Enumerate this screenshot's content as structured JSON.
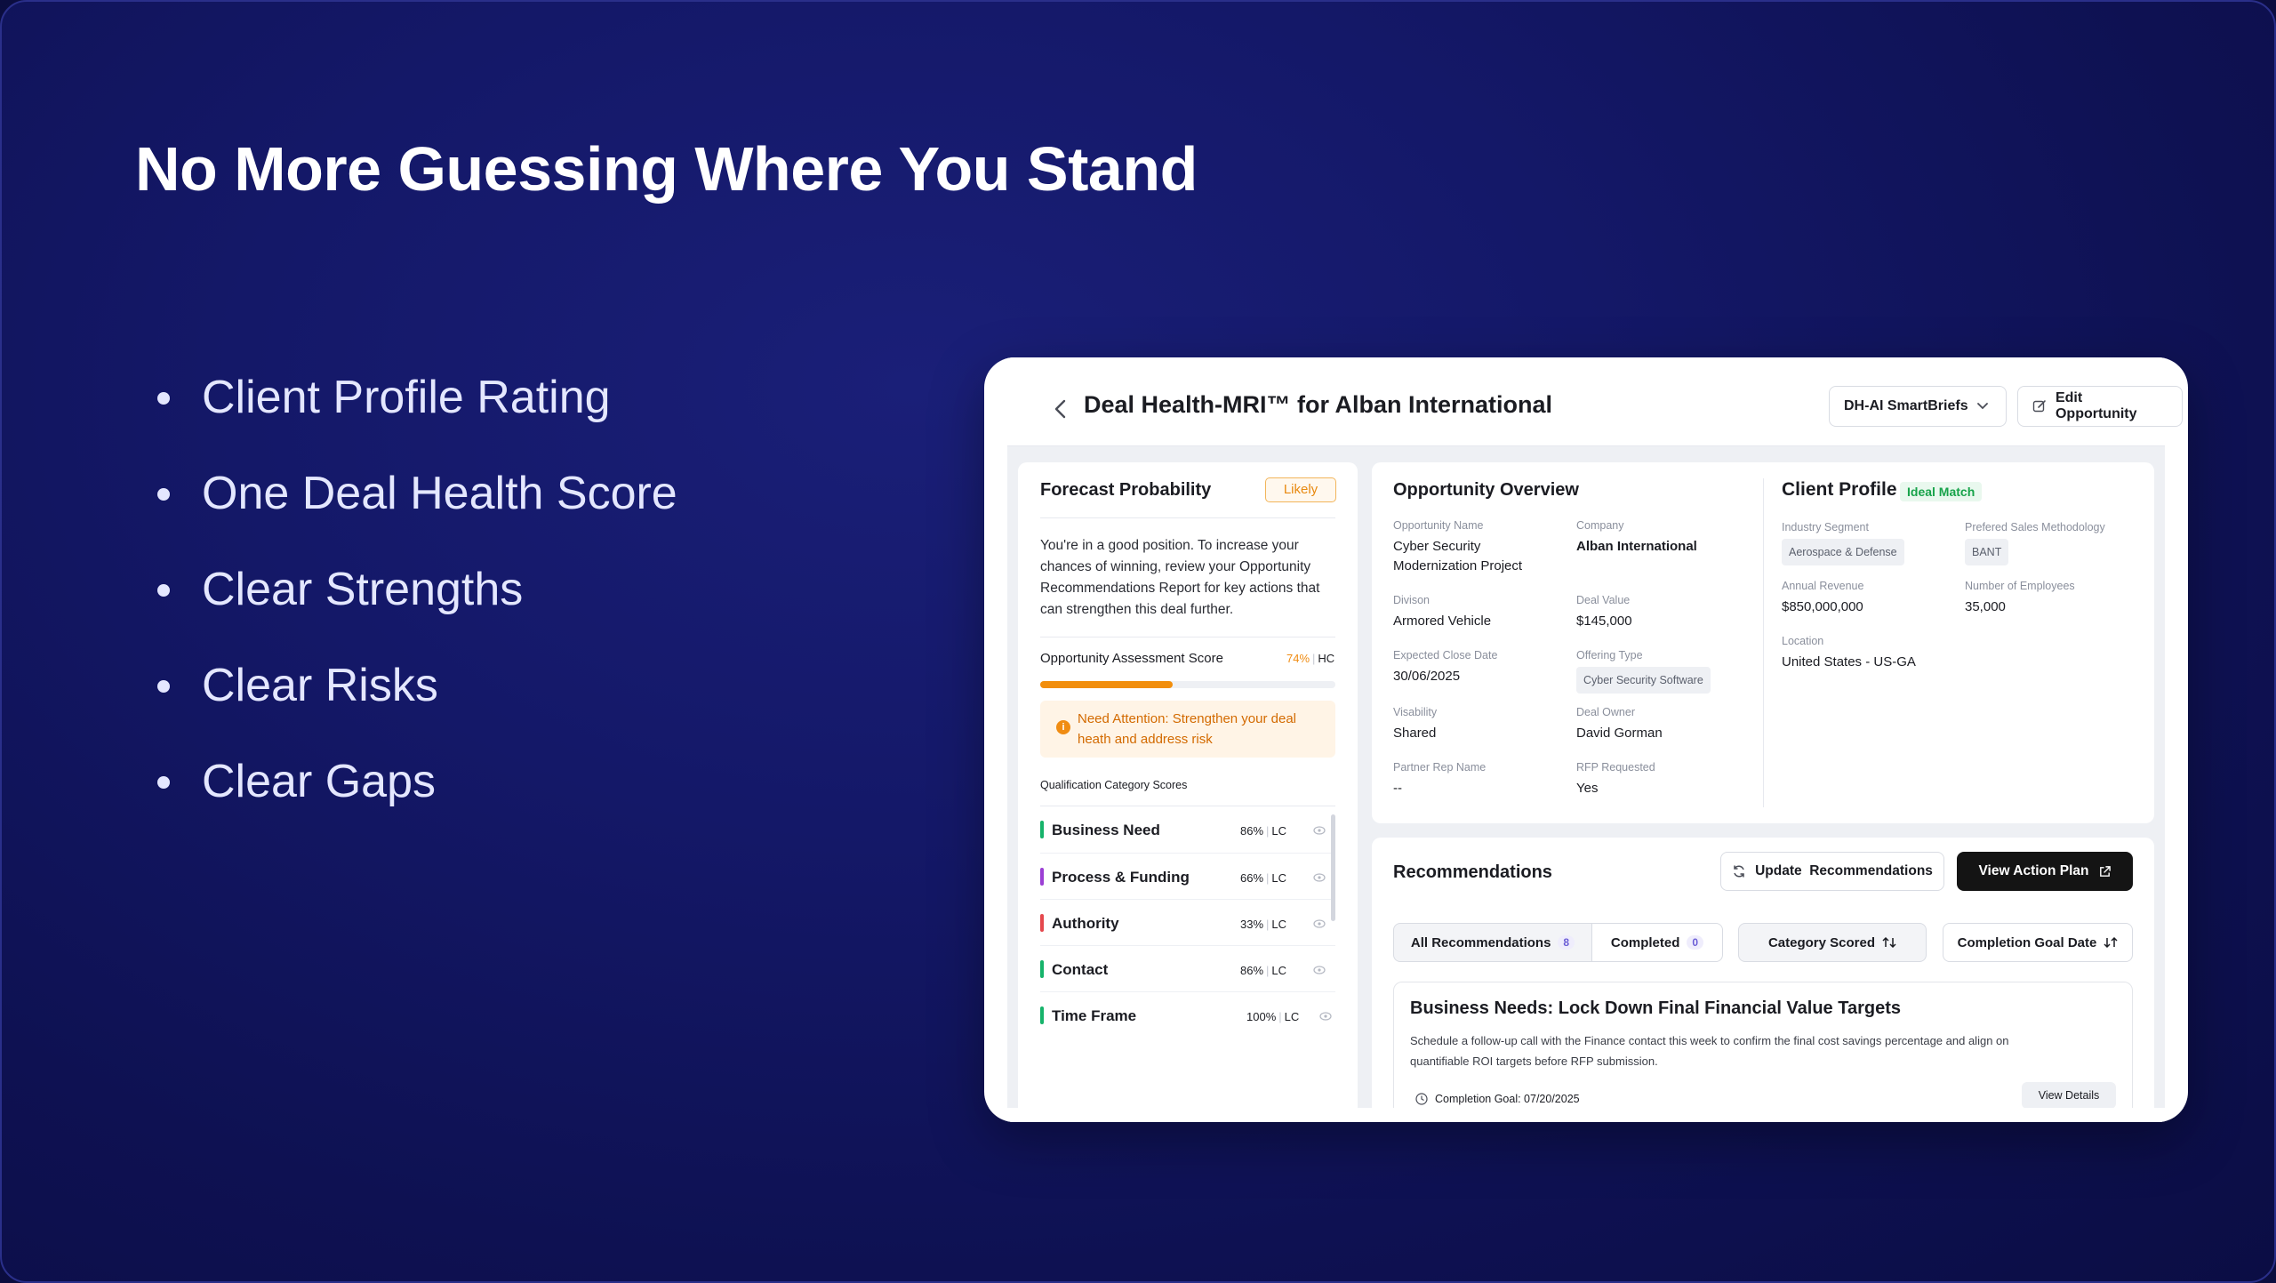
{
  "slide": {
    "headline": "No More Guessing Where You Stand",
    "bullets": [
      "Client Profile Rating",
      "One Deal Health Score",
      "Clear Strengths",
      "Clear Risks",
      "Clear Gaps"
    ]
  },
  "app": {
    "header": {
      "title": "Deal Health-MRI™ for Alban International",
      "smartbriefs_label": "DH-AI SmartBriefs",
      "edit_label": "Edit Opportunity"
    },
    "forecast": {
      "title": "Forecast Probability",
      "badge": "Likely",
      "description": "You're in a good position. To increase your chances of winning, review your Opportunity Recommendations Report for key actions that can strengthen this deal further.",
      "assessment_label": "Opportunity Assessment Score",
      "assessment_pct": "74%",
      "assessment_progress": 0.45,
      "assessment_conf": "HC",
      "attention": "Need Attention: Strengthen your deal heath and address risk",
      "categories_title": "Qualification Category Scores",
      "categories": [
        {
          "name": "Business Need",
          "score": "86%",
          "conf": "LC",
          "color": "#16b36a"
        },
        {
          "name": "Process & Funding",
          "score": "66%",
          "conf": "LC",
          "color": "#9b3fd4"
        },
        {
          "name": "Authority",
          "score": "33%",
          "conf": "LC",
          "color": "#e5484d"
        },
        {
          "name": "Contact",
          "score": "86%",
          "conf": "LC",
          "color": "#16b36a"
        },
        {
          "name": "Time Frame",
          "score": "100%",
          "conf": "LC",
          "color": "#16b36a"
        }
      ]
    },
    "overview": {
      "title": "Opportunity Overview",
      "opportunity_name_label": "Opportunity Name",
      "opportunity_name": "Cyber Security Modernization Project",
      "company_label": "Company",
      "company": "Alban International",
      "division_label": "Divison",
      "division": "Armored Vehicle",
      "deal_value_label": "Deal Value",
      "deal_value": "$145,000",
      "close_date_label": "Expected Close Date",
      "close_date": "30/06/2025",
      "offering_type_label": "Offering Type",
      "offering_type": "Cyber Security Software",
      "visibility_label": "Visability",
      "visibility": "Shared",
      "deal_owner_label": "Deal Owner",
      "deal_owner": "David Gorman",
      "partner_rep_label": "Partner Rep Name",
      "partner_rep": "--",
      "rfp_label": "RFP Requested",
      "rfp": "Yes"
    },
    "client_profile": {
      "title": "Client Profile",
      "badge": "Ideal Match",
      "industry_label": "Industry Segment",
      "industry": "Aerospace & Defense",
      "methodology_label": "Prefered Sales Methodology",
      "methodology": "BANT",
      "revenue_label": "Annual Revenue",
      "revenue": "$850,000,000",
      "employees_label": "Number of Employees",
      "employees": "35,000",
      "location_label": "Location",
      "location": "United States - US-GA"
    },
    "recommendations": {
      "title": "Recommendations",
      "update_label": "Update  Recommendations",
      "action_plan_label": "View Action Plan",
      "tab_all": "All Recommendations",
      "tab_all_count": "8",
      "tab_completed": "Completed",
      "tab_completed_count": "0",
      "sort_category": "Category Scored",
      "sort_goal": "Completion Goal Date",
      "card": {
        "title": "Business Needs: Lock Down Final Financial Value Targets",
        "description": "Schedule a follow-up call with the Finance contact this week to confirm the final cost savings percentage and align on quantifiable ROI targets before RFP submission.",
        "goal": "Completion Goal: 07/20/2025",
        "details_label": "View Details"
      }
    }
  }
}
